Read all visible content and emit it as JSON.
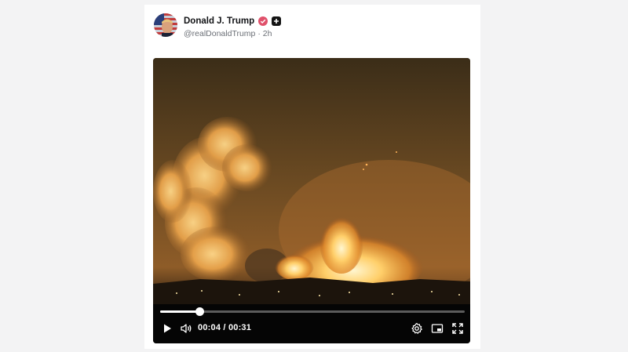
{
  "post": {
    "display_name": "Donald J. Trump",
    "handle": "@realDonaldTrump",
    "time_ago": "2h",
    "separator": "·"
  },
  "video": {
    "current_time": "00:04",
    "duration": "00:31",
    "time_separator": "/",
    "progress": 0.13
  },
  "icons": {
    "verified": "verified-badge-icon",
    "plus": "plus-badge-icon",
    "play": "play-icon",
    "volume": "volume-icon",
    "settings": "gear-icon",
    "pip": "picture-in-picture-icon",
    "fullscreen": "fullscreen-icon"
  },
  "colors": {
    "verified_badge": "#e0516b",
    "progress_fill": "#ffffff",
    "progress_track": "#5c5c5c"
  }
}
